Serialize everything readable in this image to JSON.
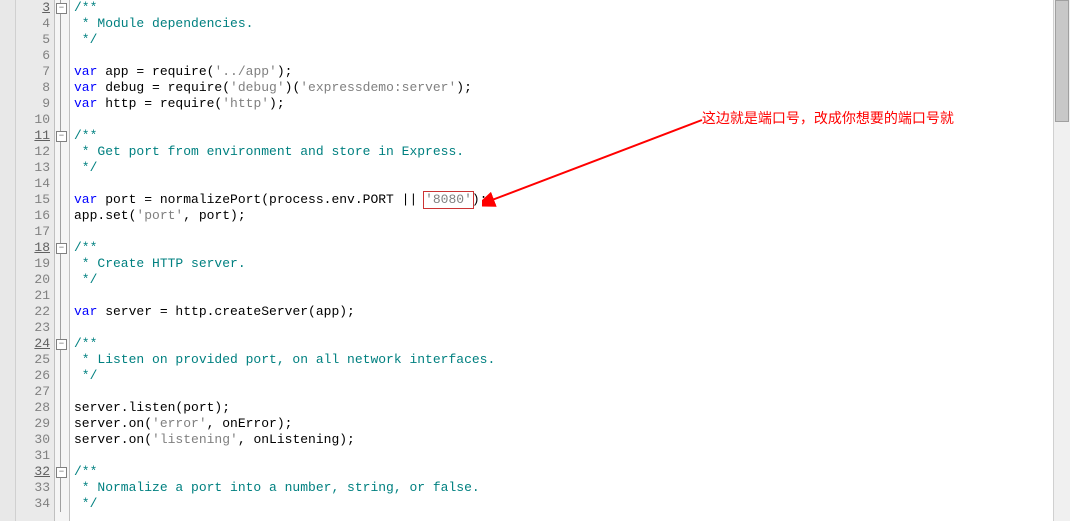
{
  "annotation": "这边就是端口号，改成你想要的端口号就",
  "highlighted_value": "'8080'",
  "lines": [
    {
      "n": "3",
      "u": true,
      "tokens": [
        [
          "cm",
          "/**"
        ]
      ]
    },
    {
      "n": "4",
      "u": false,
      "tokens": [
        [
          "cm",
          " * Module dependencies."
        ]
      ]
    },
    {
      "n": "5",
      "u": false,
      "tokens": [
        [
          "cm",
          " */"
        ]
      ]
    },
    {
      "n": "6",
      "u": false,
      "tokens": []
    },
    {
      "n": "7",
      "u": false,
      "tokens": [
        [
          "kw",
          "var"
        ],
        [
          "id",
          " app = require("
        ],
        [
          "str",
          "'../app'"
        ],
        [
          "id",
          ");"
        ]
      ]
    },
    {
      "n": "8",
      "u": false,
      "tokens": [
        [
          "kw",
          "var"
        ],
        [
          "id",
          " debug = require("
        ],
        [
          "str",
          "'debug'"
        ],
        [
          "id",
          ")("
        ],
        [
          "str",
          "'expressdemo:server'"
        ],
        [
          "id",
          ");"
        ]
      ]
    },
    {
      "n": "9",
      "u": false,
      "tokens": [
        [
          "kw",
          "var"
        ],
        [
          "id",
          " http = require("
        ],
        [
          "str",
          "'http'"
        ],
        [
          "id",
          ");"
        ]
      ]
    },
    {
      "n": "10",
      "u": false,
      "tokens": []
    },
    {
      "n": "11",
      "u": true,
      "tokens": [
        [
          "cm",
          "/**"
        ]
      ]
    },
    {
      "n": "12",
      "u": false,
      "tokens": [
        [
          "cm",
          " * Get port from environment and store in Express."
        ]
      ]
    },
    {
      "n": "13",
      "u": false,
      "tokens": [
        [
          "cm",
          " */"
        ]
      ]
    },
    {
      "n": "14",
      "u": false,
      "tokens": []
    },
    {
      "n": "15",
      "u": false,
      "tokens": [
        [
          "kw",
          "var"
        ],
        [
          "id",
          " port = normalizePort(process.env.PORT || "
        ],
        [
          "str",
          "'8080'"
        ],
        [
          "id",
          ");"
        ]
      ]
    },
    {
      "n": "16",
      "u": false,
      "tokens": [
        [
          "id",
          "app.set("
        ],
        [
          "str",
          "'port'"
        ],
        [
          "id",
          ", port);"
        ]
      ]
    },
    {
      "n": "17",
      "u": false,
      "tokens": []
    },
    {
      "n": "18",
      "u": true,
      "tokens": [
        [
          "cm",
          "/**"
        ]
      ]
    },
    {
      "n": "19",
      "u": false,
      "tokens": [
        [
          "cm",
          " * Create HTTP server."
        ]
      ]
    },
    {
      "n": "20",
      "u": false,
      "tokens": [
        [
          "cm",
          " */"
        ]
      ]
    },
    {
      "n": "21",
      "u": false,
      "tokens": []
    },
    {
      "n": "22",
      "u": false,
      "tokens": [
        [
          "kw",
          "var"
        ],
        [
          "id",
          " server = http.createServer(app);"
        ]
      ]
    },
    {
      "n": "23",
      "u": false,
      "tokens": []
    },
    {
      "n": "24",
      "u": true,
      "tokens": [
        [
          "cm",
          "/**"
        ]
      ]
    },
    {
      "n": "25",
      "u": false,
      "tokens": [
        [
          "cm",
          " * Listen on provided port, on all network interfaces."
        ]
      ]
    },
    {
      "n": "26",
      "u": false,
      "tokens": [
        [
          "cm",
          " */"
        ]
      ]
    },
    {
      "n": "27",
      "u": false,
      "tokens": []
    },
    {
      "n": "28",
      "u": false,
      "tokens": [
        [
          "id",
          "server.listen(port);"
        ]
      ]
    },
    {
      "n": "29",
      "u": false,
      "tokens": [
        [
          "id",
          "server.on("
        ],
        [
          "str",
          "'error'"
        ],
        [
          "id",
          ", onError);"
        ]
      ]
    },
    {
      "n": "30",
      "u": false,
      "tokens": [
        [
          "id",
          "server.on("
        ],
        [
          "str",
          "'listening'"
        ],
        [
          "id",
          ", onListening);"
        ]
      ]
    },
    {
      "n": "31",
      "u": false,
      "tokens": []
    },
    {
      "n": "32",
      "u": true,
      "tokens": [
        [
          "cm",
          "/**"
        ]
      ]
    },
    {
      "n": "33",
      "u": false,
      "tokens": [
        [
          "cm",
          " * Normalize a port into a number, string, or false."
        ]
      ]
    },
    {
      "n": "34",
      "u": false,
      "tokens": [
        [
          "cm",
          " */"
        ]
      ]
    }
  ],
  "fold_markers": [
    0,
    8,
    15,
    21,
    29
  ],
  "fold_marker_glyph": "−"
}
